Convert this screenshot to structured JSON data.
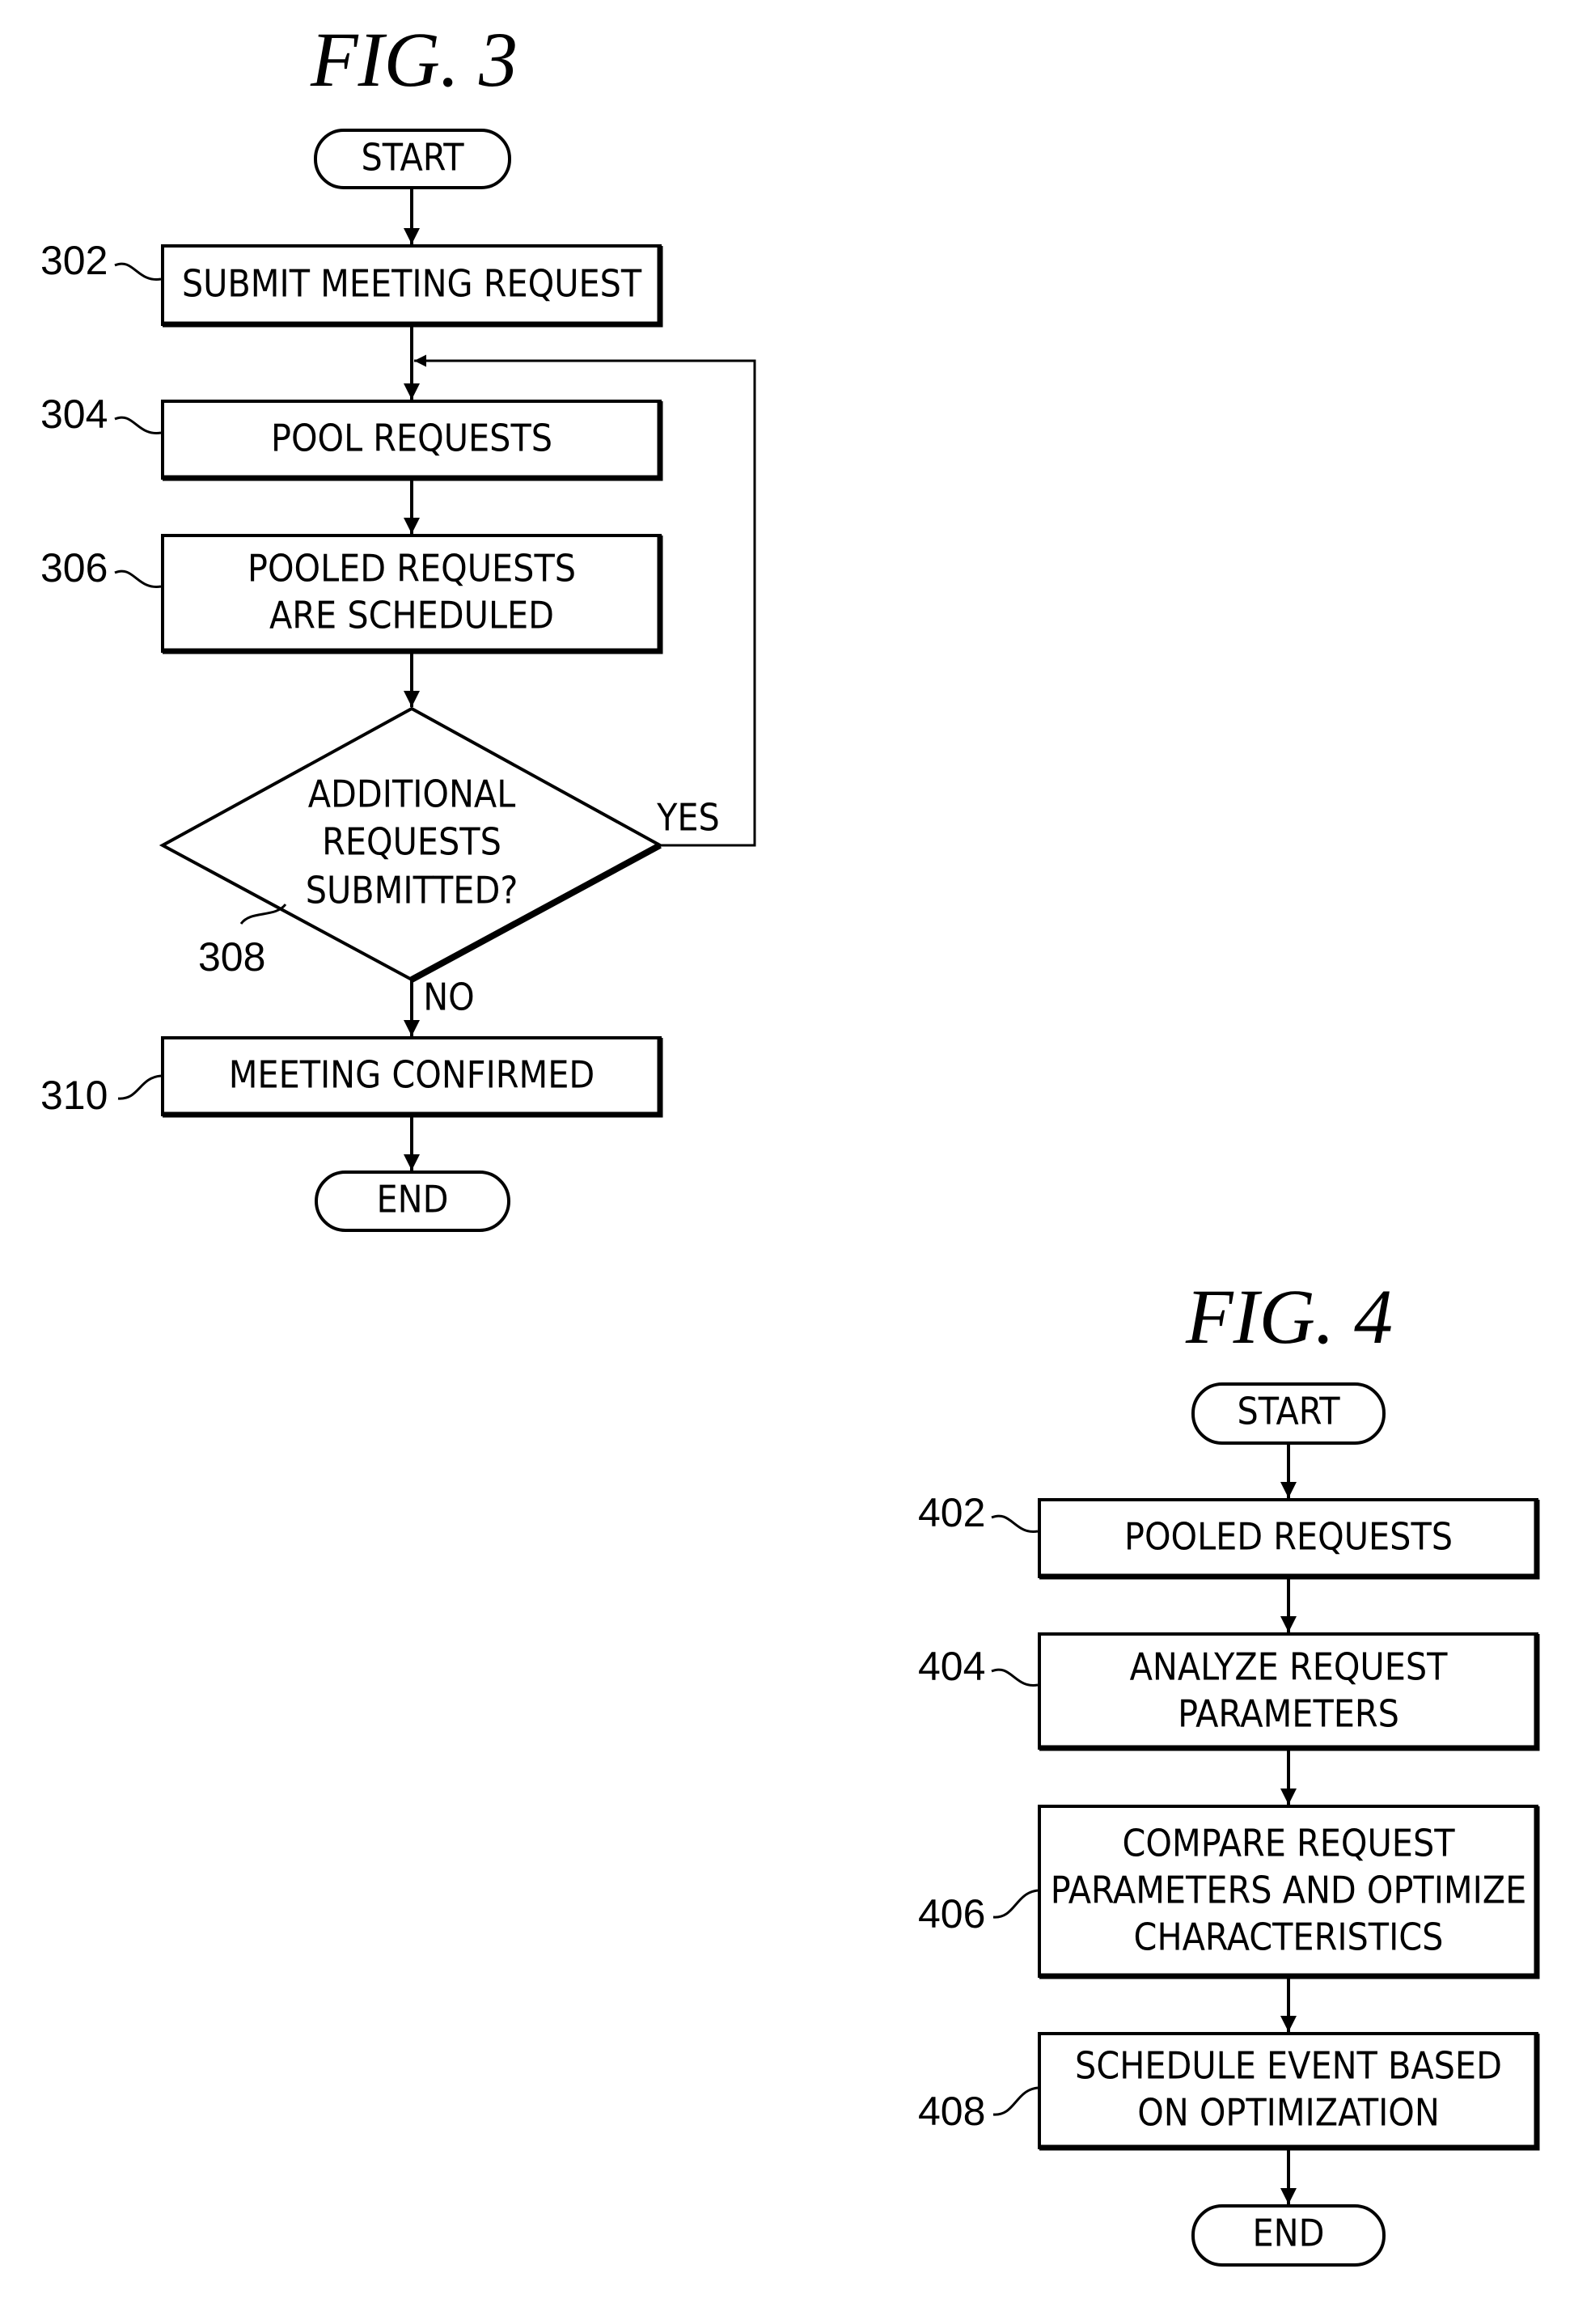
{
  "figures": [
    {
      "title": "FIG.  3",
      "start": "START",
      "end": "END",
      "steps": [
        {
          "ref": "302",
          "lines": [
            "SUBMIT MEETING REQUEST"
          ]
        },
        {
          "ref": "304",
          "lines": [
            "POOL REQUESTS"
          ]
        },
        {
          "ref": "306",
          "lines": [
            "POOLED REQUESTS",
            "ARE SCHEDULED"
          ]
        },
        {
          "ref": "308",
          "type": "decision",
          "lines": [
            "ADDITIONAL",
            "REQUESTS",
            "SUBMITTED?"
          ],
          "yes": "YES",
          "no": "NO"
        },
        {
          "ref": "310",
          "lines": [
            "MEETING CONFIRMED"
          ]
        }
      ]
    },
    {
      "title": "FIG.  4",
      "start": "START",
      "end": "END",
      "steps": [
        {
          "ref": "402",
          "lines": [
            "POOLED REQUESTS"
          ]
        },
        {
          "ref": "404",
          "lines": [
            "ANALYZE REQUEST",
            "PARAMETERS"
          ]
        },
        {
          "ref": "406",
          "lines": [
            "COMPARE REQUEST",
            "PARAMETERS AND OPTIMIZE",
            "CHARACTERISTICS"
          ]
        },
        {
          "ref": "408",
          "lines": [
            "SCHEDULE EVENT BASED",
            "ON OPTIMIZATION"
          ]
        }
      ]
    }
  ]
}
